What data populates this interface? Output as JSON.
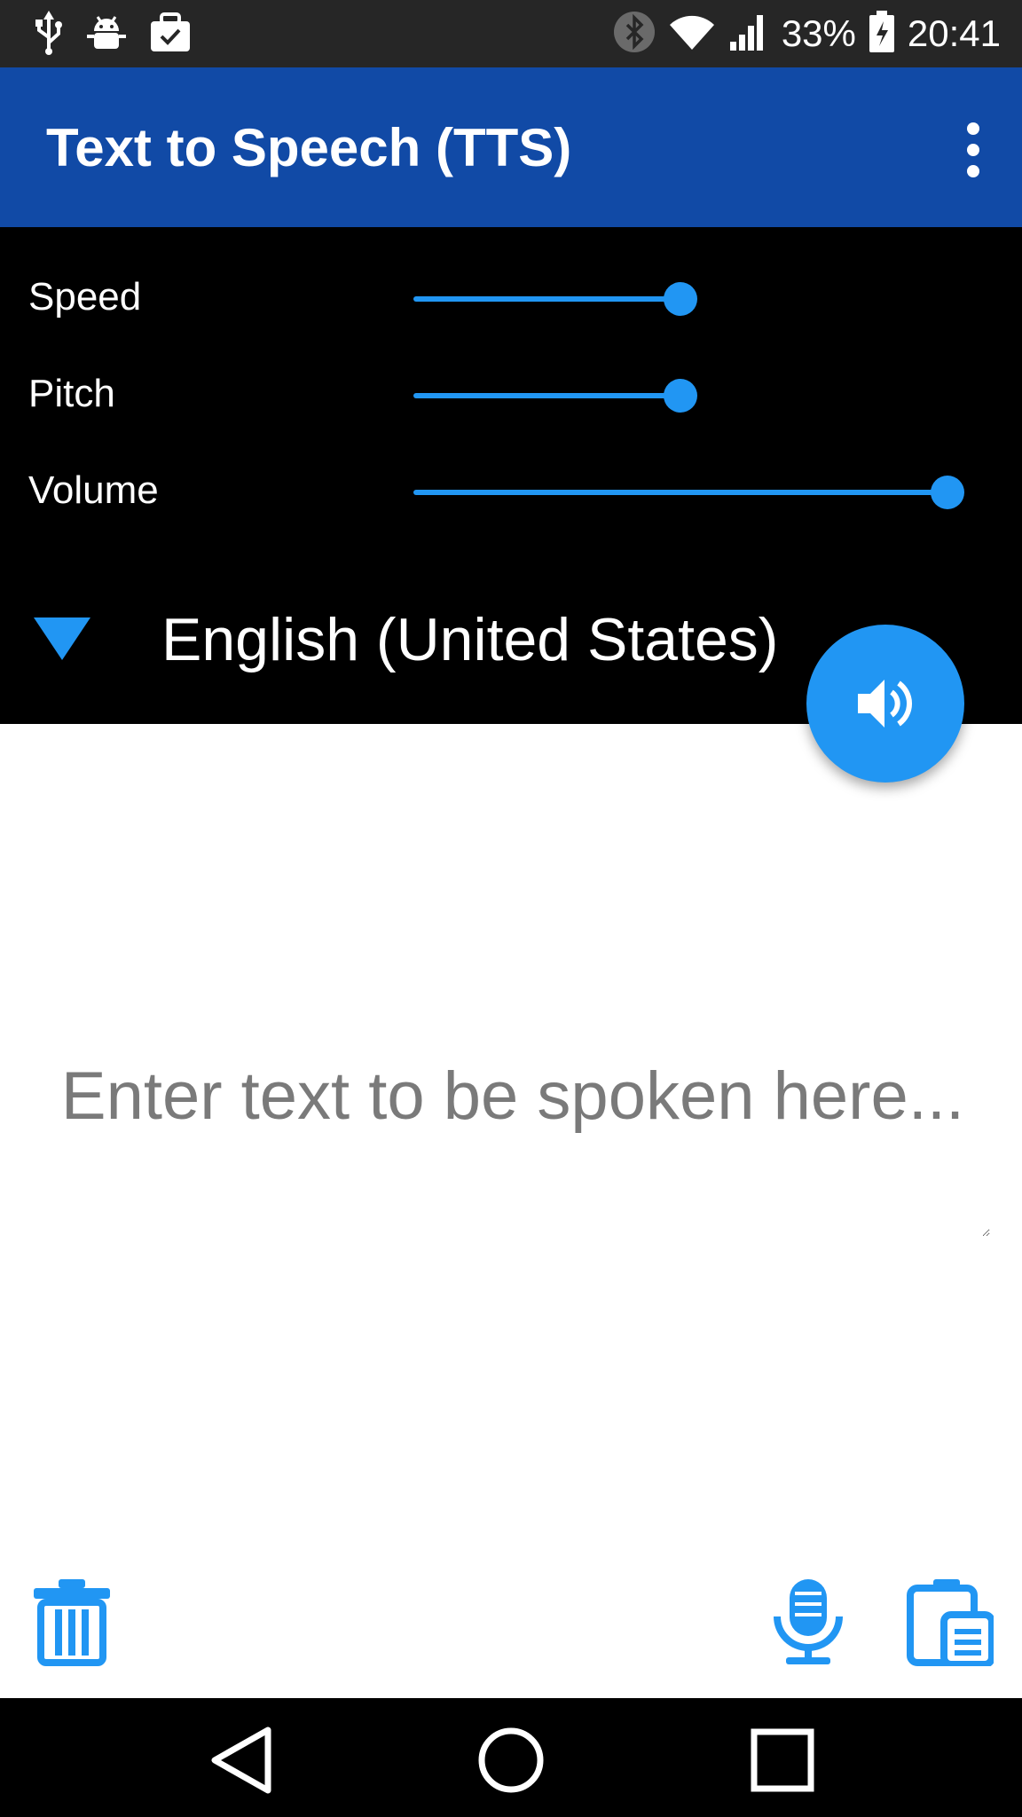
{
  "status_bar": {
    "battery_percent": "33%",
    "time": "20:41",
    "icons": [
      "usb-icon",
      "android-debug-icon",
      "work-briefcase-icon",
      "bluetooth-icon",
      "wifi-icon",
      "signal-icon",
      "battery-charging-icon"
    ]
  },
  "app_bar": {
    "title": "Text to Speech (TTS)",
    "menu_icon": "more-vert-icon"
  },
  "controls": {
    "sliders": [
      {
        "label": "Speed",
        "value": 0.5
      },
      {
        "label": "Pitch",
        "value": 0.5
      },
      {
        "label": "Volume",
        "value": 1.0
      }
    ],
    "language": "English (United States)",
    "dropdown_icon": "dropdown-triangle-icon",
    "speak_icon": "volume-up-icon"
  },
  "input": {
    "placeholder": "Enter text to be spoken here...",
    "value": ""
  },
  "actions": {
    "clear_icon": "trash-icon",
    "mic_icon": "microphone-icon",
    "paste_icon": "clipboard-icon"
  },
  "nav_bar": {
    "icons": [
      "back-icon",
      "home-icon",
      "recents-icon"
    ]
  },
  "colors": {
    "accent": "#2196f3",
    "app_bar": "#114aa6",
    "status_bar": "#262626",
    "panel": "#000000"
  }
}
